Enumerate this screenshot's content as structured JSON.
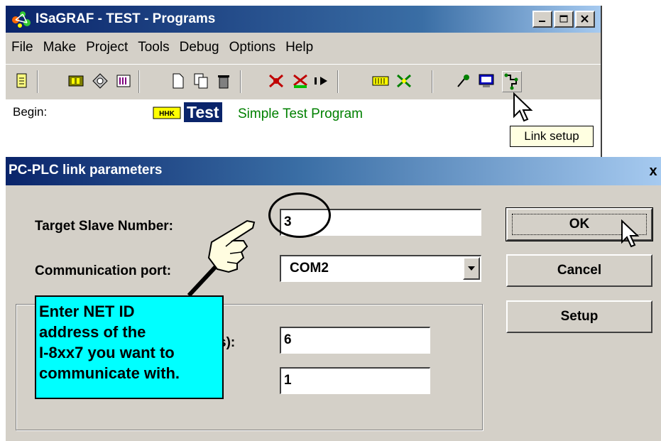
{
  "programs_window": {
    "title": "ISaGRAF - TEST - Programs",
    "window_buttons": [
      "minimize-icon",
      "maximize-icon",
      "close-icon"
    ],
    "menu": [
      "File",
      "Make",
      "Project",
      "Tools",
      "Debug",
      "Options",
      "Help"
    ],
    "toolbar_icons": [
      "document-icon",
      "dictionary-icon",
      "network-icon",
      "variables-icon",
      "new-file-icon",
      "copy-icon",
      "delete-icon",
      "debug-icon",
      "cut-icon",
      "simulate-icon",
      "io-board-icon",
      "transfer-icon",
      "probe-icon",
      "monitor-icon",
      "link-setup-icon"
    ],
    "section_label": "Begin:",
    "program": {
      "icon": "program-type-icon",
      "name": "Test",
      "description": "Simple Test Program"
    },
    "tooltip": "Link setup"
  },
  "dialog": {
    "title": "PC-PLC link parameters",
    "close_label": "x",
    "target_slave_label": "Target Slave Number:",
    "target_slave_value": "3",
    "comm_port_label": "Communication port:",
    "comm_port_value": "COM2",
    "partial_label": "s):",
    "field_1_value": "6",
    "field_2_value": "1",
    "buttons": {
      "ok": "OK",
      "cancel": "Cancel",
      "setup": "Setup"
    }
  },
  "callout": {
    "lines": [
      "Enter NET ID",
      "address of the",
      "I-8xx7 you want to",
      "communicate with."
    ],
    "color": "#00ffff"
  },
  "colors": {
    "titlebar_start": "#0a246a",
    "titlebar_end": "#a6caf0",
    "face": "#d4d0c8",
    "program_desc": "#008000"
  }
}
